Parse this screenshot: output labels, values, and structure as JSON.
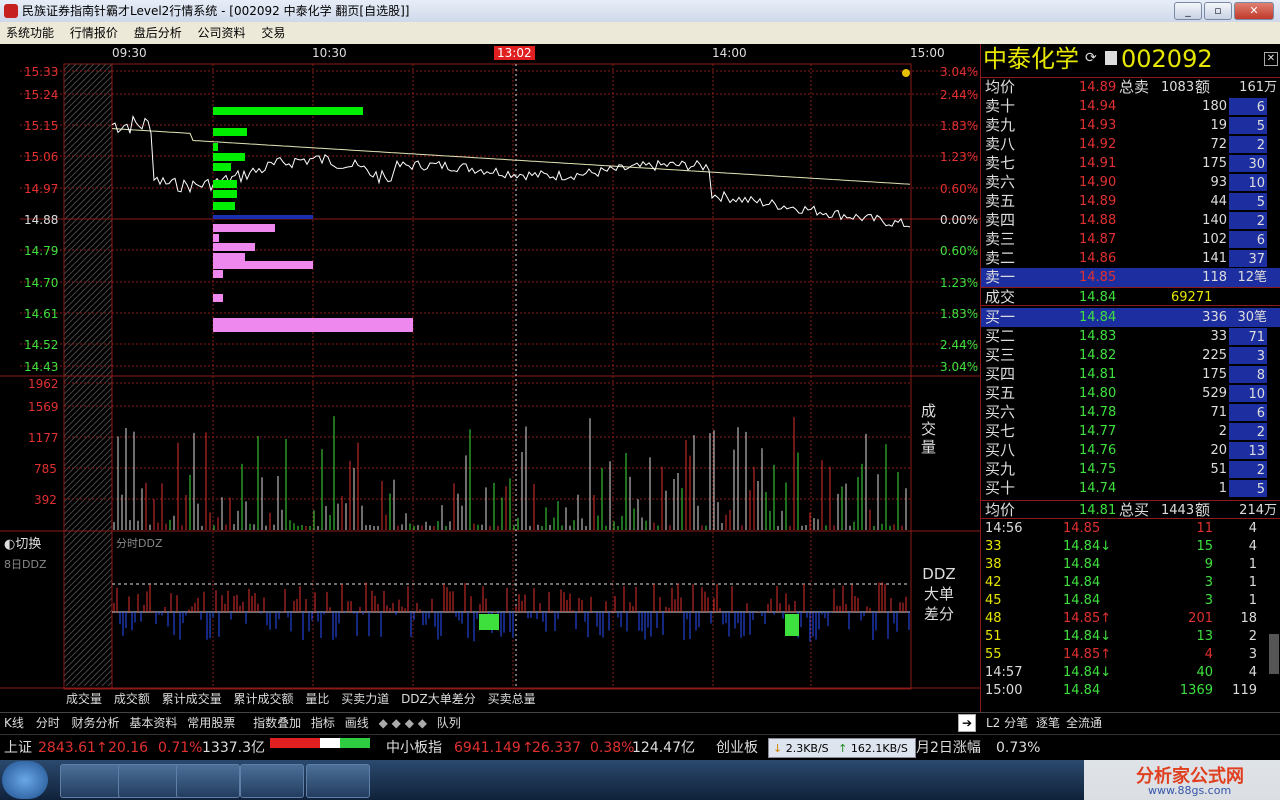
{
  "window": {
    "title": "民族证券指南针霸才Level2行情系统 - [002092 中泰化学 翻页[自选股]]",
    "buttons": [
      "_",
      "▫",
      "✕"
    ]
  },
  "menu": [
    "系统功能",
    "行情报价",
    "盘后分析",
    "公司资料",
    "交易"
  ],
  "chart": {
    "time_labels": [
      "09:30",
      "10:30",
      "13:02",
      "14:00",
      "15:00"
    ],
    "price_ticks": [
      "15.33",
      "15.24",
      "15.15",
      "15.06",
      "14.97",
      "14.88",
      "14.79",
      "14.70",
      "14.61",
      "14.52",
      "14.43"
    ],
    "pct_ticks": [
      "3.04%",
      "2.44%",
      "1.83%",
      "1.23%",
      "0.60%",
      "0.00%",
      "0.60%",
      "1.23%",
      "1.83%",
      "2.44%",
      "3.04%"
    ],
    "volume_ticks": [
      "1962",
      "1569",
      "1177",
      "785",
      "392"
    ],
    "volume_label": "成交量",
    "ddz_label": "DDZ大单差分",
    "ddz_title": "分时DDZ",
    "switch_label": "切换",
    "ddz_period": "8日DDZ",
    "colors": {
      "up": "#e03030",
      "down": "#3ee03e",
      "grid": "#8b1a1a",
      "price_line": "#ffffff",
      "avg_line": "#e6e6b8"
    }
  },
  "bottom_tabs": [
    "成交量",
    "成交额",
    "累计成交量",
    "累计成交额",
    "量比",
    "买卖力道",
    "DDZ大单差分",
    "买卖总量"
  ],
  "toolbar": {
    "left": [
      "K线",
      "分时",
      "财务分析",
      "基本资料",
      "常用股票",
      "指数叠加",
      "指标",
      "画线",
      "队列"
    ],
    "right": [
      "L2 分笔",
      "逐笔",
      "全流通"
    ]
  },
  "index_bar": {
    "sh_name": "上证",
    "sh_val": "2843.61",
    "sh_chg": "20.16",
    "sh_pct": "0.71%",
    "sh_amt": "1337.3亿",
    "zx_name": "中小板指",
    "zx_val": "6941.149",
    "zx_chg": "26.337",
    "zx_pct": "0.38%",
    "zx_amt": "124.47亿",
    "cy_name": "创业板",
    "net_down": "2.3KB/S",
    "net_up": "162.1KB/S",
    "tail": "月2日涨幅",
    "tail_pct": "0.73%"
  },
  "stock": {
    "name": "中泰化学",
    "code": "002092",
    "avg_sell_label": "均价",
    "avg_sell": "14.89",
    "total_sell_label": "总卖",
    "total_sell": "1083",
    "amt_label": "额",
    "total_sell_amt": "161万",
    "asks": [
      {
        "label": "卖十",
        "price": "14.94",
        "vol": "180",
        "cnt": "6"
      },
      {
        "label": "卖九",
        "price": "14.93",
        "vol": "19",
        "cnt": "5"
      },
      {
        "label": "卖八",
        "price": "14.92",
        "vol": "72",
        "cnt": "2"
      },
      {
        "label": "卖七",
        "price": "14.91",
        "vol": "175",
        "cnt": "30"
      },
      {
        "label": "卖六",
        "price": "14.90",
        "vol": "93",
        "cnt": "10"
      },
      {
        "label": "卖五",
        "price": "14.89",
        "vol": "44",
        "cnt": "5"
      },
      {
        "label": "卖四",
        "price": "14.88",
        "vol": "140",
        "cnt": "2"
      },
      {
        "label": "卖三",
        "price": "14.87",
        "vol": "102",
        "cnt": "6"
      },
      {
        "label": "卖二",
        "price": "14.86",
        "vol": "141",
        "cnt": "37"
      },
      {
        "label": "卖一",
        "price": "14.85",
        "vol": "118",
        "cnt": "12笔"
      }
    ],
    "deal_label": "成交",
    "deal_price": "14.84",
    "deal_vol": "69271",
    "bids": [
      {
        "label": "买一",
        "price": "14.84",
        "vol": "336",
        "cnt": "30笔"
      },
      {
        "label": "买二",
        "price": "14.83",
        "vol": "33",
        "cnt": "71"
      },
      {
        "label": "买三",
        "price": "14.82",
        "vol": "225",
        "cnt": "3"
      },
      {
        "label": "买四",
        "price": "14.81",
        "vol": "175",
        "cnt": "8"
      },
      {
        "label": "买五",
        "price": "14.80",
        "vol": "529",
        "cnt": "10"
      },
      {
        "label": "买六",
        "price": "14.78",
        "vol": "71",
        "cnt": "6"
      },
      {
        "label": "买七",
        "price": "14.77",
        "vol": "2",
        "cnt": "2"
      },
      {
        "label": "买八",
        "price": "14.76",
        "vol": "20",
        "cnt": "13"
      },
      {
        "label": "买九",
        "price": "14.75",
        "vol": "51",
        "cnt": "2"
      },
      {
        "label": "买十",
        "price": "14.74",
        "vol": "1",
        "cnt": "5"
      }
    ],
    "avg_buy_label": "均价",
    "avg_buy": "14.81",
    "total_buy_label": "总买",
    "total_buy": "1443",
    "total_buy_amt": "214万",
    "ticks": [
      {
        "t": "14:56",
        "p": "14.85",
        "v": "11",
        "n": "4"
      },
      {
        "t": "33",
        "p": "14.84↓",
        "v": "15",
        "n": "4"
      },
      {
        "t": "38",
        "p": "14.84",
        "v": "9",
        "n": "1"
      },
      {
        "t": "42",
        "p": "14.84",
        "v": "3",
        "n": "1"
      },
      {
        "t": "45",
        "p": "14.84",
        "v": "3",
        "n": "1"
      },
      {
        "t": "48",
        "p": "14.85↑",
        "v": "201",
        "n": "18"
      },
      {
        "t": "51",
        "p": "14.84↓",
        "v": "13",
        "n": "2"
      },
      {
        "t": "55",
        "p": "14.85↑",
        "v": "4",
        "n": "3"
      },
      {
        "t": "14:57",
        "p": "14.84↓",
        "v": "40",
        "n": "4"
      },
      {
        "t": "15:00",
        "p": "14.84",
        "v": "1369",
        "n": "119"
      }
    ]
  },
  "watermark": "分析家公式网",
  "watermark_url": "www.88gs.com"
}
